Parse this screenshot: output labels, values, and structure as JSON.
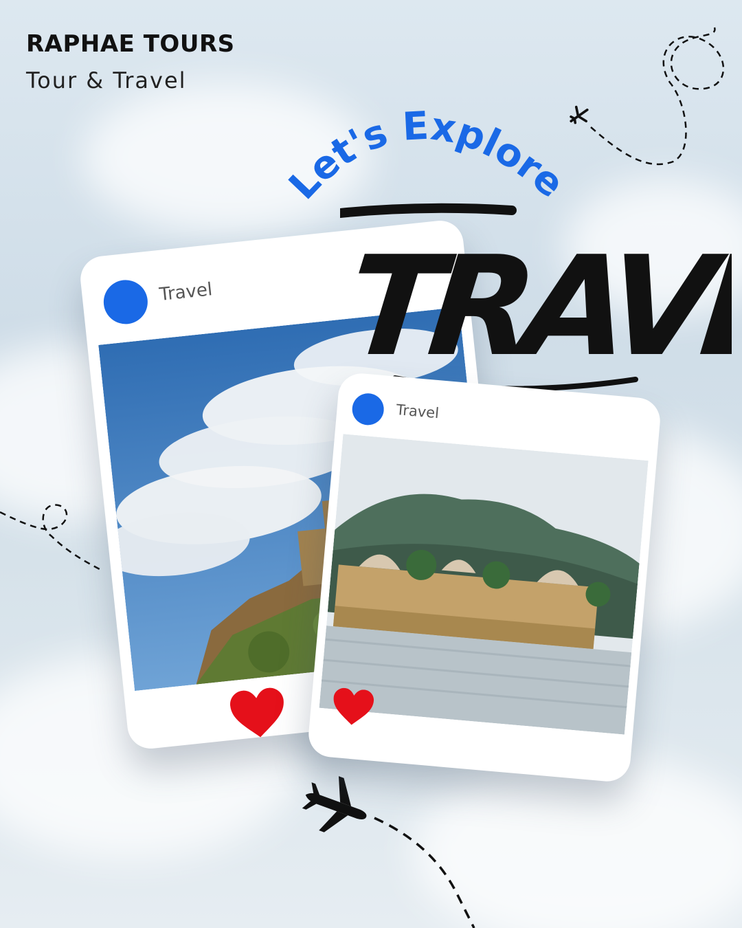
{
  "brand": {
    "name": "RAPHAE TOURS",
    "tagline": "Tour & Travel"
  },
  "headline": {
    "script": "Let's Explore",
    "main": "TRAVEL"
  },
  "cards": [
    {
      "label": "Travel",
      "liked": true,
      "icon": "heart-icon",
      "photo": "hill-fort-photo"
    },
    {
      "label": "Travel",
      "liked": true,
      "icon": "heart-icon",
      "photo": "lake-palace-photo"
    }
  ],
  "colors": {
    "accent_blue": "#1a69e6",
    "heart_red": "#e5101a",
    "ink": "#111111"
  },
  "decor": [
    "airplane-icon",
    "airplane-icon",
    "airplane-icon",
    "dashed-flight-path"
  ]
}
